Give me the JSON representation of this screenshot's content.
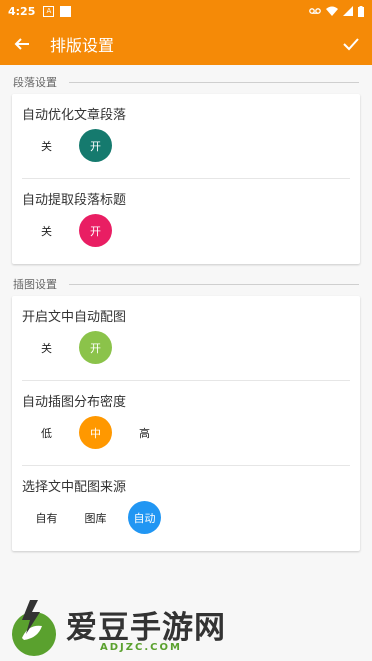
{
  "status_bar": {
    "time": "4:25",
    "icons": [
      "notification-a-icon",
      "notification-square-icon",
      "voicemail-icon",
      "wifi-icon",
      "signal-icon",
      "battery-icon"
    ]
  },
  "app_bar": {
    "title": "排版设置",
    "back_icon": "arrow-back-icon",
    "confirm_icon": "check-icon"
  },
  "sections": [
    {
      "header": "段落设置",
      "settings": [
        {
          "label": "自动优化文章段落",
          "options": [
            "关",
            "开"
          ],
          "selected": "开",
          "accent": "#157a6e"
        },
        {
          "label": "自动提取段落标题",
          "options": [
            "关",
            "开"
          ],
          "selected": "开",
          "accent": "#e91e63"
        }
      ]
    },
    {
      "header": "插图设置",
      "settings": [
        {
          "label": "开启文中自动配图",
          "options": [
            "关",
            "开"
          ],
          "selected": "开",
          "accent": "#8bc34a"
        },
        {
          "label": "自动插图分布密度",
          "options": [
            "低",
            "中",
            "高"
          ],
          "selected": "中",
          "accent": "#ff9800"
        },
        {
          "label": "选择文中配图来源",
          "options": [
            "自有",
            "图库",
            "自动"
          ],
          "selected": "自动",
          "accent": "#2196f3"
        }
      ]
    }
  ],
  "watermark": {
    "text": "爱豆手游网",
    "sub": "ADJZC.COM"
  },
  "colors": {
    "primary": "#f58a07",
    "background": "#f7f7f7"
  }
}
